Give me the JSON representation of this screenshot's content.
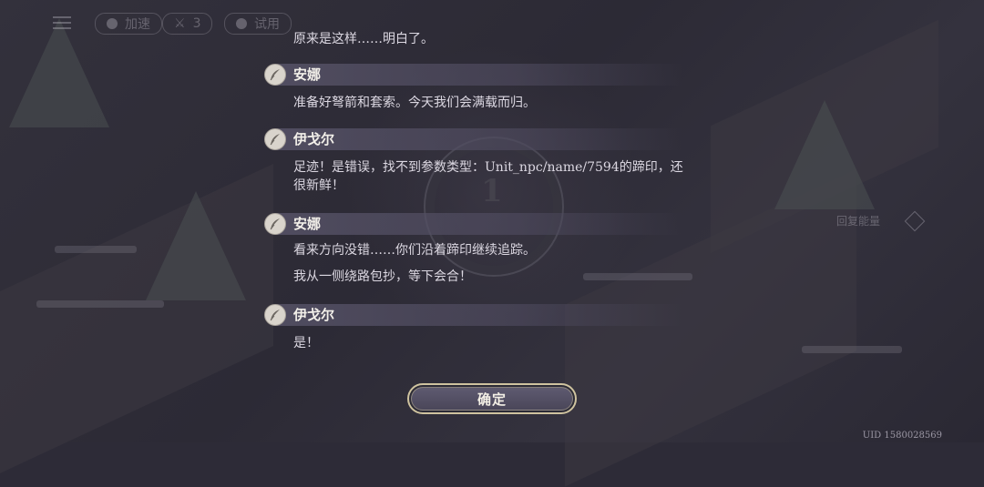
{
  "hud": {
    "speed_label": "加速",
    "count_value": "3",
    "try_label": "试用"
  },
  "scene": {
    "medallion_number": "1",
    "side_label": "回复能量"
  },
  "dialogue": {
    "entries": [
      {
        "type": "text",
        "text": "原来是这样……明白了。"
      },
      {
        "type": "speaker",
        "name": "安娜"
      },
      {
        "type": "text",
        "text": "准备好弩箭和套索。今天我们会满载而归。"
      },
      {
        "type": "speaker",
        "name": "伊戈尔"
      },
      {
        "type": "text",
        "text": "足迹！是错误，找不到参数类型：Unit_npc/name/7594的蹄印，还"
      },
      {
        "type": "text",
        "text": "很新鲜！"
      },
      {
        "type": "speaker",
        "name": "安娜"
      },
      {
        "type": "text",
        "text": "看来方向没错……你们沿着蹄印继续追踪。"
      },
      {
        "type": "text",
        "text": "我从一侧绕路包抄，等下会合！"
      },
      {
        "type": "speaker",
        "name": "伊戈尔"
      },
      {
        "type": "text",
        "text": "是！"
      }
    ],
    "speaker_icon": "feather-quill-icon"
  },
  "confirm_button": {
    "label": "确定"
  },
  "uid": "UID 1580028569",
  "colors": {
    "text": "#dcd8e2",
    "speaker_bar": "#5c586e",
    "button_border": "#cfc39f"
  }
}
